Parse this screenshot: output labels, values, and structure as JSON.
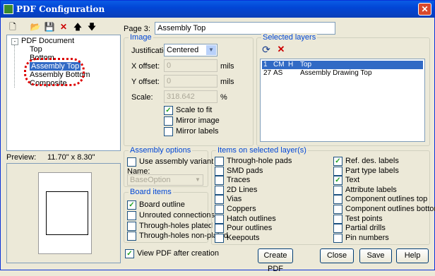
{
  "window": {
    "title": "PDF Configuration",
    "close_glyph": "✕"
  },
  "toolbar": [
    {
      "name": "new-icon",
      "glyph": "🗋"
    },
    {
      "name": "open-icon",
      "glyph": "📂"
    },
    {
      "name": "save-icon",
      "glyph": "💾"
    },
    {
      "name": "delete-icon",
      "glyph": "✕"
    },
    {
      "name": "move-up-icon",
      "glyph": "🡅"
    },
    {
      "name": "move-down-icon",
      "glyph": "🡇"
    }
  ],
  "tree": {
    "root": "PDF Document",
    "items": [
      "Top",
      "Bottom",
      "Assembly Top",
      "Assembly Bottom",
      "Composite"
    ],
    "selected": "Assembly Top"
  },
  "page": {
    "label": "Page 3:",
    "value": "Assembly Top"
  },
  "image_group": {
    "title": "Image",
    "justification_label": "Justification:",
    "justification_value": "Centered",
    "x_offset_label": "X offset:",
    "x_offset_value": "0",
    "x_offset_unit": "mils",
    "y_offset_label": "Y offset:",
    "y_offset_value": "0",
    "y_offset_unit": "mils",
    "scale_label": "Scale:",
    "scale_value": "318.642",
    "scale_unit": "%",
    "checks": [
      {
        "label": "Scale to fit",
        "checked": true
      },
      {
        "label": "Mirror image",
        "checked": false
      },
      {
        "label": "Mirror labels",
        "checked": false
      }
    ]
  },
  "selected_layers": {
    "title": "Selected layers",
    "rows": [
      {
        "num": "1",
        "code": "CM",
        "flag": "H",
        "name": "Top",
        "selected": true
      },
      {
        "num": "27",
        "code": "AS",
        "flag": "",
        "name": "Assembly Drawing Top",
        "selected": false
      }
    ]
  },
  "preview": {
    "label": "Preview:",
    "size": "11.70\" x 8.30\""
  },
  "assembly": {
    "title": "Assembly options",
    "use_variant": "Use assembly variant",
    "name_label": "Name:",
    "name_value": "BaseOption"
  },
  "board_items": {
    "title": "Board items",
    "checks": [
      {
        "label": "Board outline",
        "checked": true
      },
      {
        "label": "Unrouted connections",
        "checked": false
      },
      {
        "label": "Through-holes plated",
        "checked": false
      },
      {
        "label": "Through-holes non-plated",
        "checked": false
      }
    ]
  },
  "items_layers": {
    "title": "Items on selected layer(s)",
    "left": [
      {
        "label": "Through-hole pads",
        "checked": false
      },
      {
        "label": "SMD pads",
        "checked": false
      },
      {
        "label": "Traces",
        "checked": false
      },
      {
        "label": "2D Lines",
        "checked": false
      },
      {
        "label": "Vias",
        "checked": false
      },
      {
        "label": "Coppers",
        "checked": false
      },
      {
        "label": "Hatch outlines",
        "checked": false
      },
      {
        "label": "Pour outlines",
        "checked": false
      },
      {
        "label": "Keepouts",
        "checked": false
      }
    ],
    "right": [
      {
        "label": "Ref. des. labels",
        "checked": true
      },
      {
        "label": "Part type labels",
        "checked": false
      },
      {
        "label": "Text",
        "checked": true
      },
      {
        "label": "Attribute labels",
        "checked": false
      },
      {
        "label": "Component outlines top",
        "checked": false
      },
      {
        "label": "Component outlines bottom",
        "checked": false
      },
      {
        "label": "Test points",
        "checked": false
      },
      {
        "label": "Partial drills",
        "checked": false
      },
      {
        "label": "Pin numbers",
        "checked": false
      }
    ]
  },
  "view_pdf": {
    "label": "View PDF after creation",
    "checked": true
  },
  "buttons": {
    "create": "Create PDF",
    "close": "Close",
    "save": "Save",
    "help": "Help"
  },
  "check_glyph": "✓",
  "dropdown_glyph": "▼",
  "layer_tools": {
    "refresh": "⟳",
    "remove": "✕"
  }
}
